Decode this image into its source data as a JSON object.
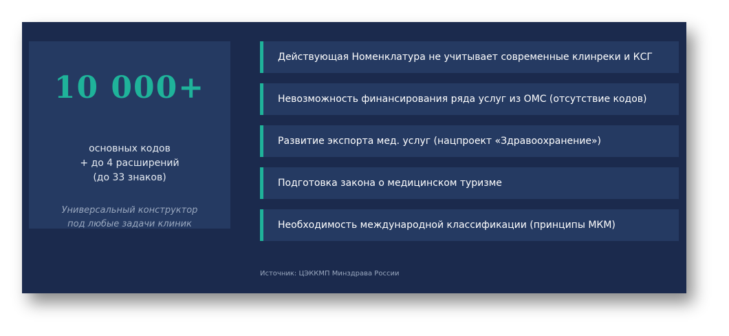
{
  "stat": {
    "value": "10 000+",
    "description": [
      "основных кодов",
      "+ до 4 расширений",
      "(до 33 знаков)"
    ],
    "note": [
      "Универсальный конструктор",
      "под любые задачи клиник"
    ]
  },
  "issues": [
    "Действующая Номенклатура не учитывает современные клинреки и КСГ",
    "Невозможность финансирования ряда услуг из ОМС (отсутствие кодов)",
    "Развитие экспорта мед. услуг (нацпроект «Здравоохранение»)",
    "Подготовка закона о медицинском туризме",
    "Необходимость международной классификации (принципы МКМ)"
  ],
  "source": "Источник: ЦЭККМП Минздрава России",
  "colors": {
    "background": "#1b2a4d",
    "panel": "#253a62",
    "accent": "#1fb39a"
  }
}
